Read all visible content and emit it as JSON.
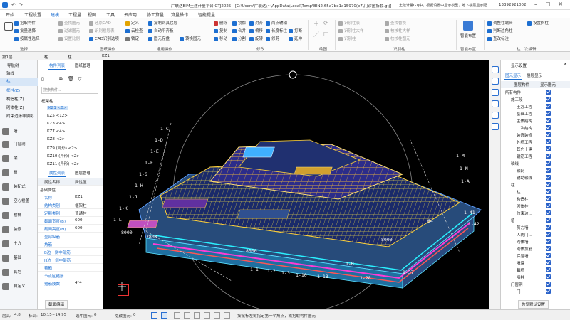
{
  "titlebar": {
    "title": "广联达BIM土建计量平台 GTJ2025 - [C:\\Users\\广联达\\~\\AppData\\Local\\Temp\\BIN2.65a7be1a15970(e7\\门诊图拆套.gtj]",
    "notice": "土建计量GTJ中，根据设置中显示模型，地下楼层显示配",
    "phone": "13392921002"
  },
  "menus": [
    "开始",
    "工程设置",
    "建模",
    "工程量",
    "视图",
    "工具",
    "云应用",
    "协工算量",
    "算量操作",
    "智能提量"
  ],
  "ribbon": {
    "select": [
      "拾取构件",
      "批量选择",
      "按属性选择"
    ],
    "drawing": [
      "查找图元",
      "过滤图元",
      "设置比例",
      "还原CAD",
      "识别楼层表",
      "CAD识别选项"
    ],
    "common": [
      "定义",
      "复制到其它层",
      "云检查",
      "锁定",
      "图元存盘",
      "自动平齐板",
      "转换图元"
    ],
    "modify": [
      "删除",
      "复制",
      "移动",
      "镜像",
      "合并",
      "分割",
      "对齐",
      "偏移",
      "两点辅轴",
      "长度标注",
      "修剪",
      "打断",
      "延伸",
      "旋转"
    ],
    "identify": [
      "识别柱表",
      "识别柱大样",
      "识别柱",
      "查找替换",
      "校核柱大样",
      "校核柱图元"
    ],
    "smart": [
      "智能布置"
    ],
    "col_edit": [
      "调整柱端头",
      "判断边角柱",
      "查改标注",
      "设置斜柱"
    ],
    "groups": [
      "选择",
      "图纸操作",
      "通用操作",
      "修改",
      "绘图",
      "识别柱",
      "智能布置",
      "柱二次编辑"
    ]
  },
  "filterbar": {
    "floor": "第1层",
    "category": "柱",
    "type": "柱",
    "component": "KZ1"
  },
  "leftnav": {
    "title": "导航树",
    "items": [
      "轴线",
      "柱",
      "框柱(Z)",
      "构造柱(Z)",
      "砌体柱(Z)",
      "约束边缘非阴影",
      "墙",
      "门窗洞",
      "梁",
      "板",
      "装配式",
      "空心楼盖",
      "楼梯",
      "装修",
      "土方",
      "基础",
      "其它",
      "自定义"
    ]
  },
  "component_list": {
    "tabs": [
      "构件列表",
      "图纸管理"
    ],
    "search_placeholder": "搜索构件...",
    "group": "框架柱",
    "items": [
      "KZ1 <0>",
      "KZ5 <12>",
      "KZ3 <4>",
      "KZ7 <4>",
      "KZ8 <2>",
      "KZ9 (异形) <2>",
      "KZ10 (异形) <2>",
      "KZ11 (异形) <2>"
    ]
  },
  "properties": {
    "tabs": [
      "属性列表",
      "图层管理"
    ],
    "headers": [
      "属性名称",
      "属性值"
    ],
    "group": "基础属性",
    "rows": [
      [
        "名称",
        "KZ1"
      ],
      [
        "结构类别",
        "框架柱"
      ],
      [
        "定额类别",
        "普通柱"
      ],
      [
        "截面宽度(B)",
        "600"
      ],
      [
        "截面高度(H)",
        "600"
      ],
      [
        "全部纵筋",
        ""
      ],
      [
        "角筋",
        ""
      ],
      [
        "B边一侧中部筋",
        ""
      ],
      [
        "H边一侧中部筋",
        ""
      ],
      [
        "箍筋",
        ""
      ],
      [
        "节点区箍筋",
        ""
      ],
      [
        "箍筋肢数",
        "4*4"
      ]
    ],
    "button": "截面编辑"
  },
  "display": {
    "title": "显示设置",
    "tabs": [
      "图元显示",
      "楼层显示"
    ],
    "headers": [
      "图层构件",
      "显示图元"
    ],
    "rows": [
      [
        "所有构件",
        0
      ],
      [
        "施工段",
        1
      ],
      [
        "土方工程",
        2
      ],
      [
        "基础工程",
        2
      ],
      [
        "主体结构",
        2
      ],
      [
        "二次结构",
        2
      ],
      [
        "装饰装修",
        2
      ],
      [
        "外墙工程",
        2
      ],
      [
        "其它土建",
        2
      ],
      [
        "钢筋工程",
        2
      ],
      [
        "轴线",
        1
      ],
      [
        "轴网",
        2
      ],
      [
        "辅助轴线",
        2
      ],
      [
        "柱",
        1
      ],
      [
        "柱",
        2
      ],
      [
        "构造柱",
        2
      ],
      [
        "砌体柱",
        2
      ],
      [
        "约束边...",
        2
      ],
      [
        "墙",
        1
      ],
      [
        "剪力墙",
        2
      ],
      [
        "人防门...",
        2
      ],
      [
        "砌体墙",
        2
      ],
      [
        "砌体加筋",
        2
      ],
      [
        "保温墙",
        2
      ],
      [
        "墙垛",
        2
      ],
      [
        "幕墙",
        2
      ],
      [
        "墙柱",
        2
      ],
      [
        "门窗洞",
        1
      ],
      [
        "门",
        2
      ]
    ],
    "button": "恢复默认设置"
  },
  "statusbar": {
    "floor_label": "层高:",
    "floor_value": "4.8",
    "elev_label": "标高:",
    "elev_value": "10.15~14.95",
    "sel_label": "选中图元:",
    "sel_value": "0",
    "hidden_label": "隐藏图元:",
    "hidden_value": "0",
    "hint": "按鼠标左键指定第一个角点，或拾取构件图元"
  },
  "axis_labels": [
    "1-C",
    "1-D",
    "1-E",
    "1-F",
    "1-G",
    "1-H",
    "1-J",
    "1-K",
    "1-L",
    "1-M",
    "1-N",
    "1-A",
    "1-B",
    "1-1",
    "1-2",
    "1-3",
    "1-10",
    "1-18",
    "1-28",
    "1-37",
    "1-41",
    "1-42",
    "8000",
    "7800",
    "8000",
    "8000",
    "64"
  ]
}
